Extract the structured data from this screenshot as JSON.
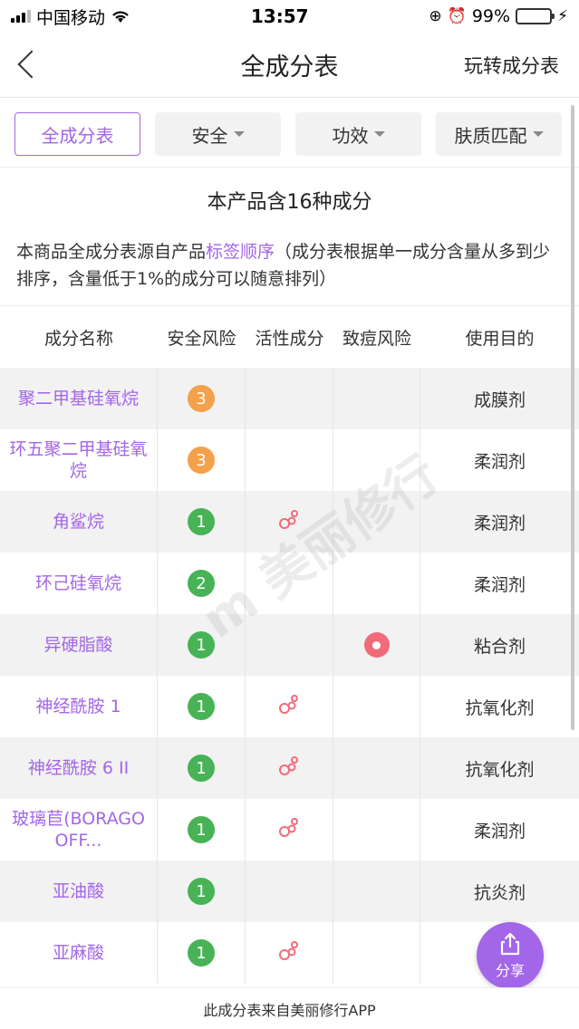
{
  "status_bar": {
    "carrier": "中国移动",
    "time": "13:57",
    "battery": "99%"
  },
  "nav": {
    "title": "全成分表",
    "right_link": "玩转成分表"
  },
  "filters": [
    {
      "label": "全成分表",
      "active": true
    },
    {
      "label": "安全",
      "dropdown": true
    },
    {
      "label": "功效",
      "dropdown": true
    },
    {
      "label": "肤质匹配",
      "dropdown": true
    }
  ],
  "summary": "本产品含16种成分",
  "description": {
    "prefix": "本商品全成分表源自产品",
    "highlight": "标签顺序",
    "suffix": "（成分表根据单一成分含量从多到少排序，含量低于1%的成分可以随意排列）"
  },
  "table": {
    "headers": [
      "成分名称",
      "安全风险",
      "活性成分",
      "致痘风险",
      "使用目的"
    ],
    "rows": [
      {
        "name": "聚二甲基硅氧烷",
        "risk": "3",
        "risk_color": "orange",
        "active": false,
        "acne": false,
        "purpose": "成膜剂"
      },
      {
        "name": "环五聚二甲基硅氧烷",
        "risk": "3",
        "risk_color": "orange",
        "active": false,
        "acne": false,
        "purpose": "柔润剂"
      },
      {
        "name": "角鲨烷",
        "risk": "1",
        "risk_color": "green",
        "active": true,
        "acne": false,
        "purpose": "柔润剂"
      },
      {
        "name": "环己硅氧烷",
        "risk": "2",
        "risk_color": "green",
        "active": false,
        "acne": false,
        "purpose": "柔润剂"
      },
      {
        "name": "异硬脂酸",
        "risk": "1",
        "risk_color": "green",
        "active": false,
        "acne": true,
        "purpose": "粘合剂"
      },
      {
        "name": "神经酰胺 1",
        "risk": "1",
        "risk_color": "green",
        "active": true,
        "acne": false,
        "purpose": "抗氧化剂"
      },
      {
        "name": "神经酰胺 6 II",
        "risk": "1",
        "risk_color": "green",
        "active": true,
        "acne": false,
        "purpose": "抗氧化剂"
      },
      {
        "name": "玻璃苣(BORAGO OFF...",
        "risk": "1",
        "risk_color": "green",
        "active": true,
        "acne": false,
        "purpose": "柔润剂"
      },
      {
        "name": "亚油酸",
        "risk": "1",
        "risk_color": "green",
        "active": false,
        "acne": false,
        "purpose": "抗炎剂"
      },
      {
        "name": "亚麻酸",
        "risk": "1",
        "risk_color": "green",
        "active": true,
        "acne": false,
        "purpose": ""
      }
    ]
  },
  "watermark": "美丽修行",
  "share_label": "分享",
  "footer": "此成分表来自美丽修行APP",
  "colors": {
    "accent": "#a366e8",
    "risk_green": "#47b356",
    "risk_orange": "#f5a04a",
    "acne_red": "#f26a7a"
  }
}
